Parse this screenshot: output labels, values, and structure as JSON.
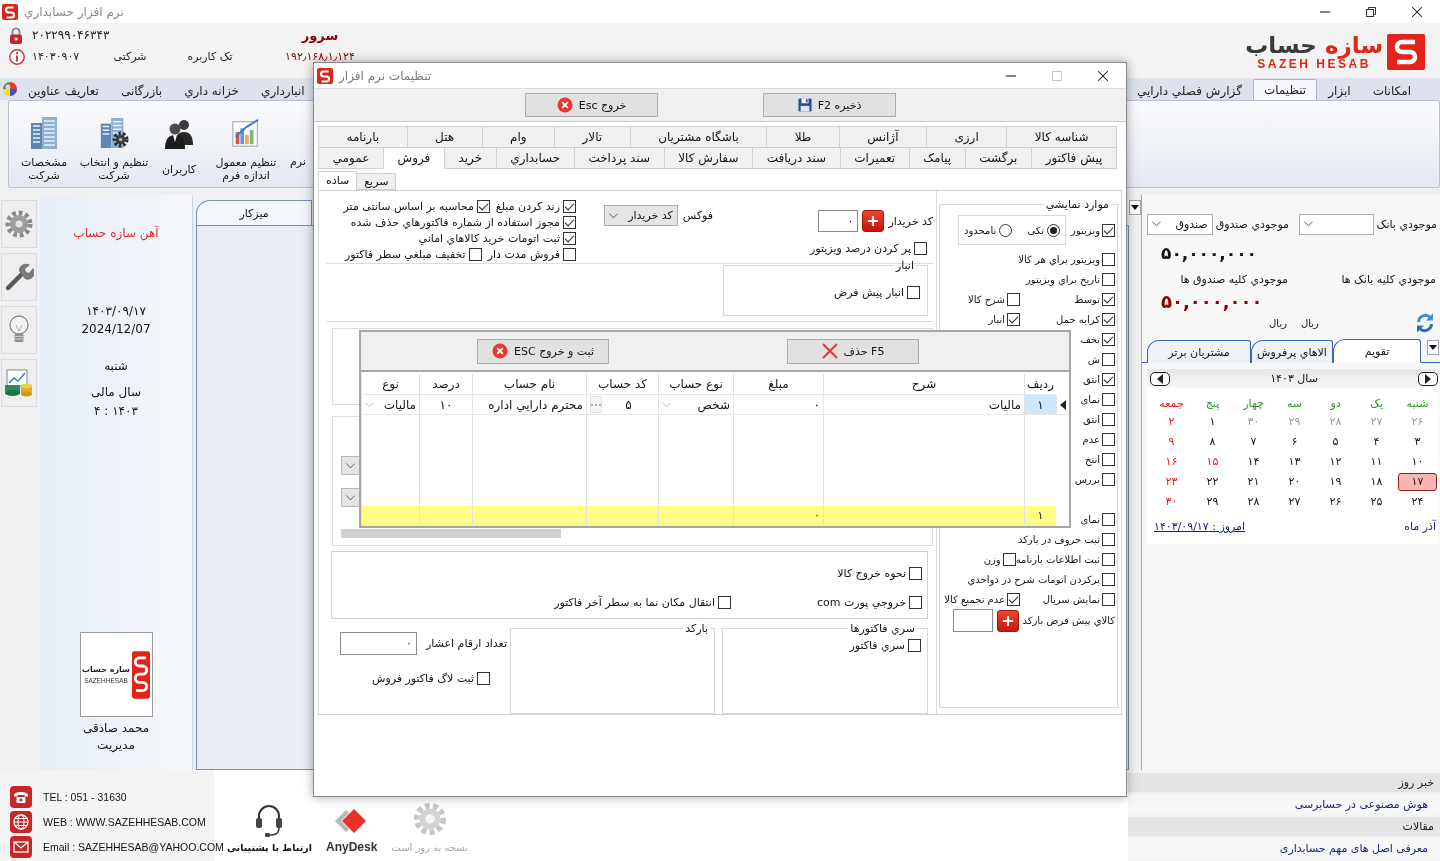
{
  "window": {
    "title": "نرم افزار حسابداري"
  },
  "header": {
    "serial": "۲۰۲۲۹۹۰۴۶۳۴۳",
    "server_label": "سرور",
    "date_code": "۱۴۰۳۰۹۰۷",
    "license_type": "شرکتی",
    "user_mode": "تک کاربره",
    "server_address": "۱۹۲٫۱۶۸٫۱٫۱۲۴",
    "logo": {
      "text": "سازه حساب",
      "latin": "SAZEH HESAB"
    }
  },
  "ribbon": {
    "tab_groups": [
      {
        "tabs": [
          {
            "label": "امکانات",
            "selected": false
          },
          {
            "label": "ابزار",
            "selected": false
          },
          {
            "label": "تنظیمات",
            "selected": true
          },
          {
            "label": "گزارش فصلي دارايي",
            "selected": false
          }
        ]
      },
      {
        "tabs": [
          {
            "label": "انبارداري",
            "selected": false
          },
          {
            "label": "خزانه داري",
            "selected": false
          },
          {
            "label": "بازرگانی",
            "selected": false
          },
          {
            "label": "تعاریف عناوین",
            "selected": false
          }
        ]
      }
    ],
    "buttons": [
      {
        "label": "نرم"
      },
      {
        "label": "تنظیم معمول اندازه فرم"
      },
      {
        "label": "کاربران"
      },
      {
        "label": "تنظیم و انتخاب شرکت"
      },
      {
        "label": "مشخصات شرکت"
      }
    ]
  },
  "company_panel": {
    "company": "آهن سازه حساب",
    "date_jalali": "۱۴۰۳/۰۹/۱۷",
    "date_gregorian": "2024/12/07",
    "weekday": "شنبه",
    "fiscal_year_label": "سال مالی",
    "fiscal_year": "۴ : ۱۴۰۳",
    "logo": {
      "text": "سازه حساب",
      "latin": "SAZEHHESAB"
    },
    "user": {
      "name": "محمد صادقی",
      "role": "مدیریت"
    }
  },
  "workspace": {
    "tabs": [
      {
        "label": "میزکار",
        "selected": true
      }
    ]
  },
  "side_panel": {
    "bank": {
      "label": "موجودي بانک",
      "total_label": "موجودي کلیه بانک ها",
      "currency": "ریال"
    },
    "cash": {
      "label": "موجودي صندوق",
      "selected": "صندوق",
      "balance": "۵۰,۰۰۰,۰۰۰",
      "total_label": "موجودي کلیه صندوق ها",
      "total": "۵۰,۰۰۰,۰۰۰",
      "currency": "ریال"
    },
    "tabs": [
      {
        "label": "تقویم",
        "selected": true
      },
      {
        "label": "الاهاي پرفروش",
        "selected": false
      },
      {
        "label": "مشتریان برتر",
        "selected": false
      }
    ],
    "calendar": {
      "year_label": "سال ۱۴۰۳",
      "weekdays": [
        {
          "label": "شنبه",
          "kind": "workday"
        },
        {
          "label": "یک",
          "kind": "workday"
        },
        {
          "label": "دو",
          "kind": "workday"
        },
        {
          "label": "سه",
          "kind": "workday"
        },
        {
          "label": "چهار",
          "kind": "workday"
        },
        {
          "label": "پنج",
          "kind": "workday"
        },
        {
          "label": "جمعه",
          "kind": "holiday"
        }
      ],
      "weeks": [
        {
          "days": [
            {
              "label": "۲۶",
              "kind": "other",
              "selected": false
            },
            {
              "label": "۲۷",
              "kind": "other",
              "selected": false
            },
            {
              "label": "۲۸",
              "kind": "other",
              "selected": false
            },
            {
              "label": "۲۹",
              "kind": "other",
              "selected": false
            },
            {
              "label": "۳۰",
              "kind": "other",
              "selected": false
            },
            {
              "label": "۱",
              "kind": "normal",
              "selected": false
            },
            {
              "label": "۲",
              "kind": "holiday",
              "selected": false
            }
          ]
        },
        {
          "days": [
            {
              "label": "۳",
              "kind": "normal",
              "selected": false
            },
            {
              "label": "۴",
              "kind": "normal",
              "selected": false
            },
            {
              "label": "۵",
              "kind": "normal",
              "selected": false
            },
            {
              "label": "۶",
              "kind": "normal",
              "selected": false
            },
            {
              "label": "۷",
              "kind": "normal",
              "selected": false
            },
            {
              "label": "۸",
              "kind": "normal",
              "selected": false
            },
            {
              "label": "۹",
              "kind": "holiday",
              "selected": false
            }
          ]
        },
        {
          "days": [
            {
              "label": "۱۰",
              "kind": "normal",
              "selected": false
            },
            {
              "label": "۱۱",
              "kind": "normal",
              "selected": false
            },
            {
              "label": "۱۲",
              "kind": "normal",
              "selected": false
            },
            {
              "label": "۱۳",
              "kind": "normal",
              "selected": false
            },
            {
              "label": "۱۴",
              "kind": "normal",
              "selected": false
            },
            {
              "label": "۱۵",
              "kind": "holiday",
              "selected": false
            },
            {
              "label": "۱۶",
              "kind": "holiday",
              "selected": false
            }
          ]
        },
        {
          "days": [
            {
              "label": "۱۷",
              "kind": "normal",
              "selected": true
            },
            {
              "label": "۱۸",
              "kind": "normal",
              "selected": false
            },
            {
              "label": "۱۹",
              "kind": "normal",
              "selected": false
            },
            {
              "label": "۲۰",
              "kind": "normal",
              "selected": false
            },
            {
              "label": "۲۱",
              "kind": "normal",
              "selected": false
            },
            {
              "label": "۲۲",
              "kind": "normal",
              "selected": false
            },
            {
              "label": "۲۳",
              "kind": "holiday",
              "selected": false
            }
          ]
        },
        {
          "days": [
            {
              "label": "۲۴",
              "kind": "normal",
              "selected": false
            },
            {
              "label": "۲۵",
              "kind": "normal",
              "selected": false
            },
            {
              "label": "۲۶",
              "kind": "normal",
              "selected": false
            },
            {
              "label": "۲۷",
              "kind": "normal",
              "selected": false
            },
            {
              "label": "۲۸",
              "kind": "normal",
              "selected": false
            },
            {
              "label": "۲۹",
              "kind": "normal",
              "selected": false
            },
            {
              "label": "۳۰",
              "kind": "holiday",
              "selected": false
            }
          ]
        }
      ],
      "month": "آذر ماه",
      "today": "امروز : ۱۴۰۳/۰۹/۱۷"
    }
  },
  "news": {
    "sections": [
      {
        "title": "خبر روز",
        "items": [
          "هوش مصنوعی در حسابرسی"
        ]
      },
      {
        "title": "مقالات",
        "items": [
          "معرفی اصل های مهم حسابداری"
        ]
      }
    ]
  },
  "footer": {
    "tel": "TEL : 051 - 31630",
    "web": "WEB : WWW.SAZEHHESAB.COM",
    "email": "Email : SAZEHHESAB@YAHOO.COM",
    "launchers": [
      {
        "label": "نسخه به روز است",
        "disabled": true
      },
      {
        "label": "AnyDesk",
        "disabled": false
      },
      {
        "label": "ارتباط با پشتیبانی",
        "disabled": false
      }
    ]
  },
  "dialog": {
    "title": "تنظیمات نرم افزار",
    "toolbar": [
      {
        "label": "ذخیره F2",
        "kind": "save"
      },
      {
        "label": "خروج Esc",
        "kind": "exit"
      }
    ],
    "tab_rows": [
      {
        "tabs": [
          {
            "label": "شناسه کالا",
            "selected": false
          },
          {
            "label": "ارزی",
            "selected": false
          },
          {
            "label": "آژانس",
            "selected": false
          },
          {
            "label": "طلا",
            "selected": false
          },
          {
            "label": "باشگاه مشتریان",
            "selected": false
          },
          {
            "label": "تالار",
            "selected": false
          },
          {
            "label": "وام",
            "selected": false
          },
          {
            "label": "هتل",
            "selected": false
          },
          {
            "label": "بارنامه",
            "selected": false
          }
        ]
      },
      {
        "tabs": [
          {
            "label": "پیش فاکتور",
            "selected": false
          },
          {
            "label": "برگشت",
            "selected": false
          },
          {
            "label": "پیامک",
            "selected": false
          },
          {
            "label": "تعمیرات",
            "selected": false
          },
          {
            "label": "سند دریافت",
            "selected": false
          },
          {
            "label": "سفارش کالا",
            "selected": false
          },
          {
            "label": "سند پرداخت",
            "selected": false
          },
          {
            "label": "حسابداري",
            "selected": false
          },
          {
            "label": "خرید",
            "selected": false
          },
          {
            "label": "فروش",
            "selected": true
          },
          {
            "label": "عمومي",
            "selected": false
          }
        ]
      }
    ],
    "subtabs": [
      {
        "label": "سریع",
        "selected": false
      },
      {
        "label": "ساده",
        "selected": true
      }
    ],
    "sales": {
      "buyer_code": {
        "label": "کد خریدار",
        "value": "۰"
      },
      "fill_visitor_percent": {
        "label": "پر کردن درصد ویزیتور",
        "checked": false
      },
      "focus": {
        "label": "فوکس",
        "value": "کد خریدار"
      },
      "option_rows": [
        {
          "items": [
            {
              "label": "رند کردن مبلغ",
              "checked": true
            },
            {
              "label": "محاسبه بر اساس سانتی متر",
              "checked": true
            }
          ]
        },
        {
          "items": [
            {
              "label": "مجوز استفاده از شماره فاکتورهاي حذف شده",
              "checked": true
            }
          ]
        },
        {
          "items": [
            {
              "label": "ثبت اتومات خرید کالاهاي اماني",
              "checked": true
            }
          ]
        },
        {
          "items": [
            {
              "label": "فروش مدت دار",
              "checked": false
            },
            {
              "label": "تخفیف مبلغي سطر فاکتور",
              "checked": false
            }
          ]
        }
      ],
      "warehouse_group": {
        "title": "انبار",
        "option": {
          "label": "انبار پیش فرض",
          "checked": false
        }
      },
      "output_rows": [
        {
          "items": [
            {
              "label": "نحوه خروج کالا",
              "checked": false
            }
          ]
        },
        {
          "items": [
            {
              "label": "خروجي پورت com",
              "checked": false
            },
            {
              "label": "انتقال مکان نما به سطر آخر فاکتور",
              "checked": false
            }
          ]
        }
      ],
      "invoice_series_group": {
        "title": "سري فاکتورها",
        "option": {
          "label": "سري فاکتور",
          "checked": false
        }
      },
      "barcode_group": {
        "title": "بارکد"
      },
      "decimal_digits": {
        "label": "تعداد ارقام اعشار",
        "value": "۰"
      },
      "sales_log": {
        "label": "ثبت لاگ فاکتور فروش",
        "checked": false
      },
      "display_group": {
        "title": "موارد نمایشي",
        "sections": [
          {
            "rows": [
              {
                "items": [
                  {
                    "kind": "checkbox",
                    "label": "ویزیتور",
                    "checked": true
                  },
                  {
                    "kind": "radio_group",
                    "options": [
                      {
                        "label": "تکی",
                        "selected": true
                      },
                      {
                        "label": "نامحدود",
                        "selected": false
                      }
                    ]
                  }
                ]
              },
              {
                "items": [
                  {
                    "kind": "checkbox",
                    "label": "ویزیتور براي هر کالا",
                    "checked": false
                  }
                ]
              },
              {
                "items": [
                  {
                    "kind": "checkbox",
                    "label": "تاریخ براي ویزیتور",
                    "checked": false
                  }
                ]
              },
              {
                "items": [
                  {
                    "kind": "checkbox",
                    "label": "توسط",
                    "checked": true
                  },
                  {
                    "kind": "checkbox",
                    "label": "شرح کالا",
                    "checked": false
                  }
                ]
              },
              {
                "items": [
                  {
                    "kind": "checkbox",
                    "label": "کرایه حمل",
                    "checked": true
                  },
                  {
                    "kind": "checkbox",
                    "label": "انبار",
                    "checked": true
                  }
                ]
              },
              {
                "items": [
                  {
                    "kind": "checkbox",
                    "label": "تخف",
                    "checked": true
                  }
                ]
              },
              {
                "items": [
                  {
                    "kind": "checkbox",
                    "label": "ش",
                    "checked": false
                  }
                ]
              },
              {
                "items": [
                  {
                    "kind": "checkbox",
                    "label": "انتق",
                    "checked": true
                  }
                ]
              },
              {
                "items": [
                  {
                    "kind": "checkbox",
                    "label": "نمای",
                    "checked": false
                  }
                ]
              },
              {
                "items": [
                  {
                    "kind": "checkbox",
                    "label": "انتق",
                    "checked": false
                  }
                ]
              },
              {
                "items": [
                  {
                    "kind": "checkbox",
                    "label": "عدم",
                    "checked": false
                  }
                ]
              },
              {
                "items": [
                  {
                    "kind": "checkbox",
                    "label": "انتخ",
                    "checked": false
                  }
                ]
              },
              {
                "items": [
                  {
                    "kind": "checkbox",
                    "label": "بررس",
                    "checked": false
                  }
                ]
              }
            ]
          },
          {
            "rows": [
              {
                "items": [
                  {
                    "kind": "checkbox",
                    "label": "نمای",
                    "checked": false
                  }
                ]
              },
              {
                "items": [
                  {
                    "kind": "checkbox",
                    "label": "ثبت حروف در بارکد",
                    "checked": false
                  }
                ]
              },
              {
                "items": [
                  {
                    "kind": "checkbox",
                    "label": "ثبت اطلاعات بارنامه",
                    "checked": false
                  },
                  {
                    "kind": "checkbox",
                    "label": "وزن",
                    "checked": false
                  }
                ]
              },
              {
                "items": [
                  {
                    "kind": "checkbox",
                    "label": "پرکردن اتومات شرح در دواحدي",
                    "checked": false
                  }
                ]
              },
              {
                "items": [
                  {
                    "kind": "checkbox",
                    "label": "نمایش سریال",
                    "checked": false
                  },
                  {
                    "kind": "checkbox",
                    "label": "عدم تجمیع کالا",
                    "checked": true
                  }
                ]
              },
              {
                "items": [
                  {
                    "kind": "lookup",
                    "label": "کالاي پیش فرض بارکد"
                  }
                ]
              }
            ]
          }
        ]
      }
    },
    "tax_popup": {
      "toolbar": [
        {
          "label": "F5 حذف",
          "kind": "delete"
        },
        {
          "label": "ثبت و خروج ESC",
          "kind": "exit"
        }
      ],
      "columns": [
        {
          "label": "ردیف",
          "kind": "number"
        },
        {
          "label": "شرح",
          "kind": "text"
        },
        {
          "label": "مبلغ",
          "kind": "amount"
        },
        {
          "label": "نوع حساب",
          "kind": "combo"
        },
        {
          "label": "کد حساب",
          "kind": "lookup"
        },
        {
          "label": "نام حساب",
          "kind": "text"
        },
        {
          "label": "درصد",
          "kind": "number"
        },
        {
          "label": "نوع",
          "kind": "combo"
        }
      ],
      "rows": [
        {
          "selected": true,
          "cells": [
            "۱",
            "مالیات",
            "۰",
            "شخص",
            "۵",
            "محترم دارايي اداره",
            "۱۰",
            "مالیات"
          ]
        }
      ],
      "footer": {
        "row_count": "۱",
        "amount": "۰"
      }
    }
  }
}
